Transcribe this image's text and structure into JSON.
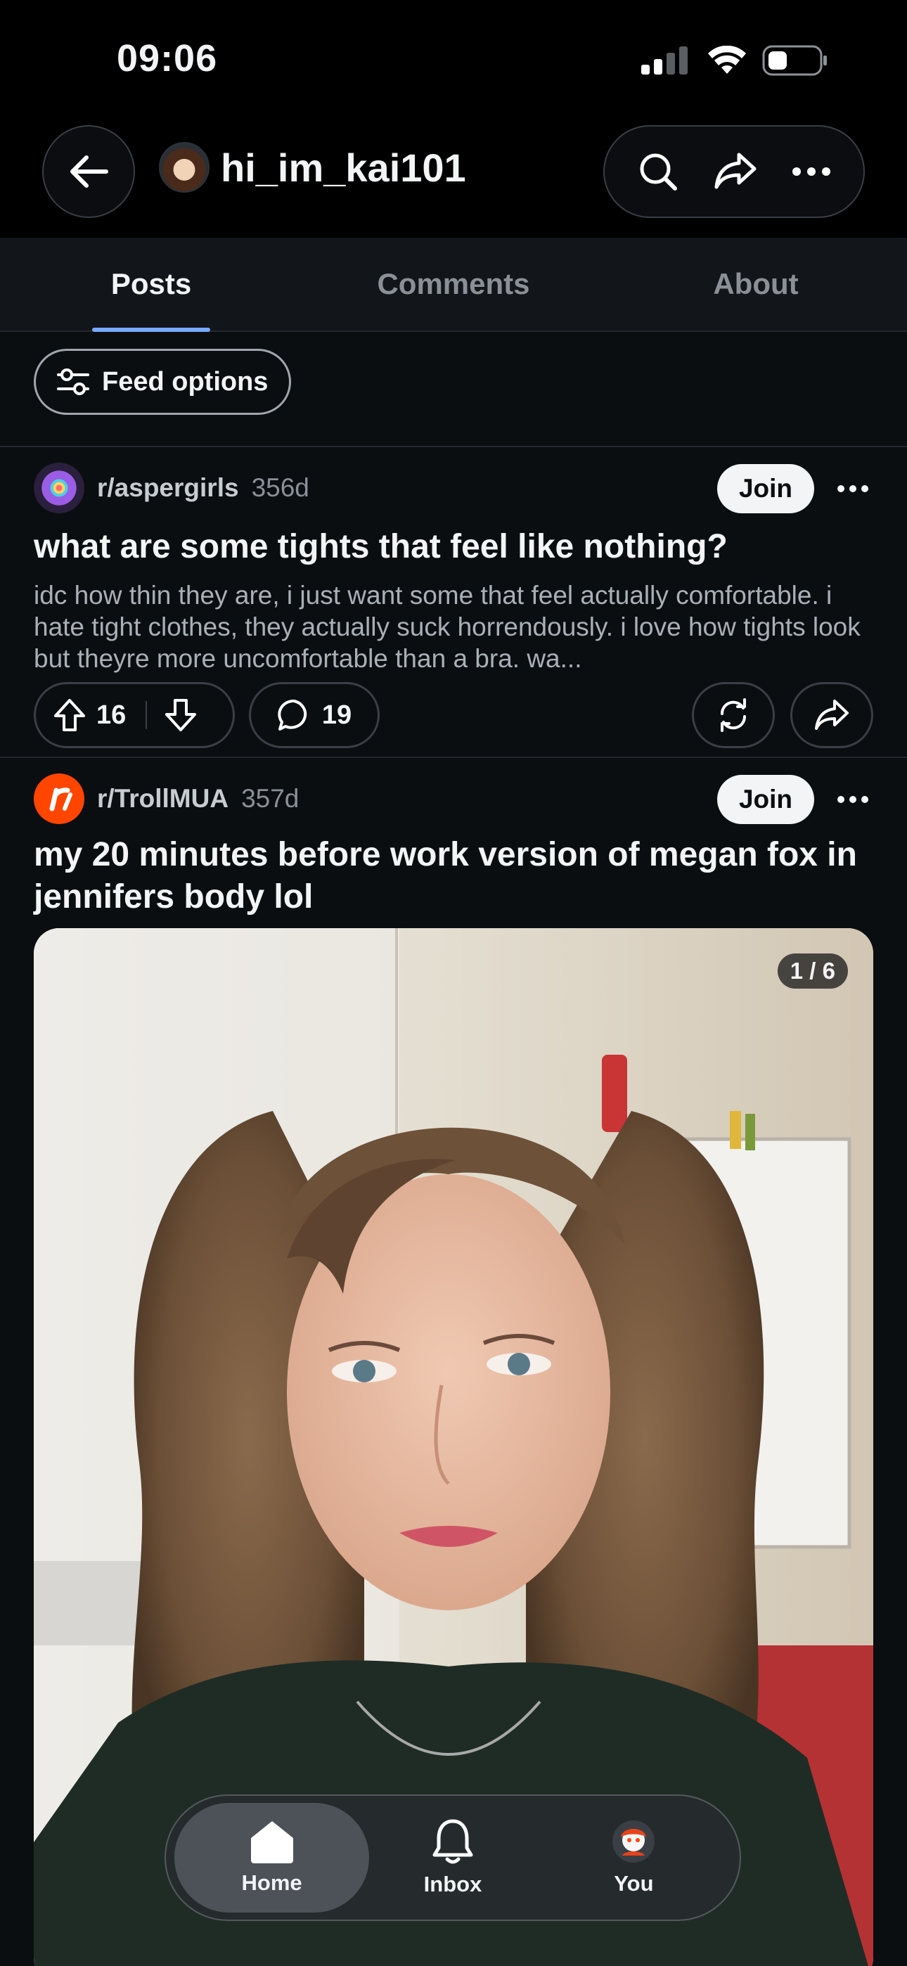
{
  "status": {
    "time": "09:06"
  },
  "header": {
    "username": "hi_im_kai101"
  },
  "tabs": [
    {
      "label": "Posts",
      "active": true
    },
    {
      "label": "Comments",
      "active": false
    },
    {
      "label": "About",
      "active": false
    }
  ],
  "feed": {
    "options_label": "Feed options"
  },
  "posts": [
    {
      "subreddit": "r/aspergirls",
      "age": "356d",
      "join_label": "Join",
      "title": "what are some tights that feel like nothing?",
      "body": "idc how thin they are, i just want some that feel actually comfortable. i hate tight clothes, they actually suck horrendously. i love how tights look but theyre more uncomfortable than a bra. wa...",
      "votes": "16",
      "comments": "19"
    },
    {
      "subreddit": "r/TrollMUA",
      "age": "357d",
      "join_label": "Join",
      "title": "my 20 minutes before work version of megan fox in jennifers body lol",
      "image_counter": "1 / 6"
    }
  ],
  "nav": [
    {
      "label": "Home",
      "icon": "home-icon",
      "active": true
    },
    {
      "label": "Inbox",
      "icon": "bell-icon",
      "active": false
    },
    {
      "label": "You",
      "icon": "avatar-icon",
      "active": false
    }
  ],
  "colors": {
    "accent": "#7aa9ff",
    "background": "#0b0e11",
    "reddit_orange": "#ff4500"
  }
}
